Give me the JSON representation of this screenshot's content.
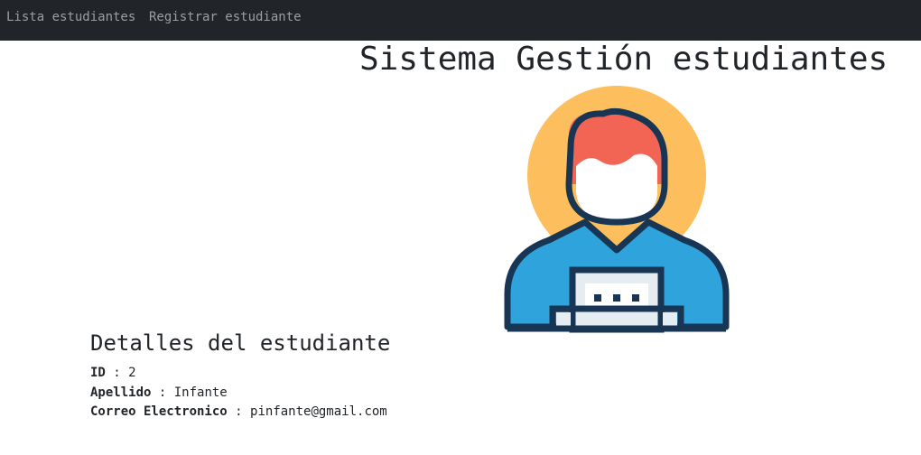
{
  "nav": {
    "items": [
      {
        "label": "Lista estudiantes"
      },
      {
        "label": "Registrar estudiante"
      }
    ]
  },
  "header": {
    "title": "Sistema Gestión estudiantes"
  },
  "avatar": {
    "icon": "student-avatar-icon",
    "colors": {
      "circle": "#FDBE5E",
      "hair": "#F26454",
      "shirt": "#2FA3DC",
      "outline": "#183653",
      "laptop": "#E6EDF2"
    }
  },
  "details": {
    "title": "Detalles del estudiante",
    "fields": [
      {
        "label": "ID",
        "separator": " : ",
        "value": "2"
      },
      {
        "label": "Apellido",
        "separator": " : ",
        "value": "Infante"
      },
      {
        "label": "Correo Electronico",
        "separator": " : ",
        "value": "pinfante@gmail.com"
      }
    ]
  },
  "colors": {
    "navbar_bg": "#212529",
    "nav_text": "rgba(255,255,255,0.55)",
    "text": "#212529"
  }
}
